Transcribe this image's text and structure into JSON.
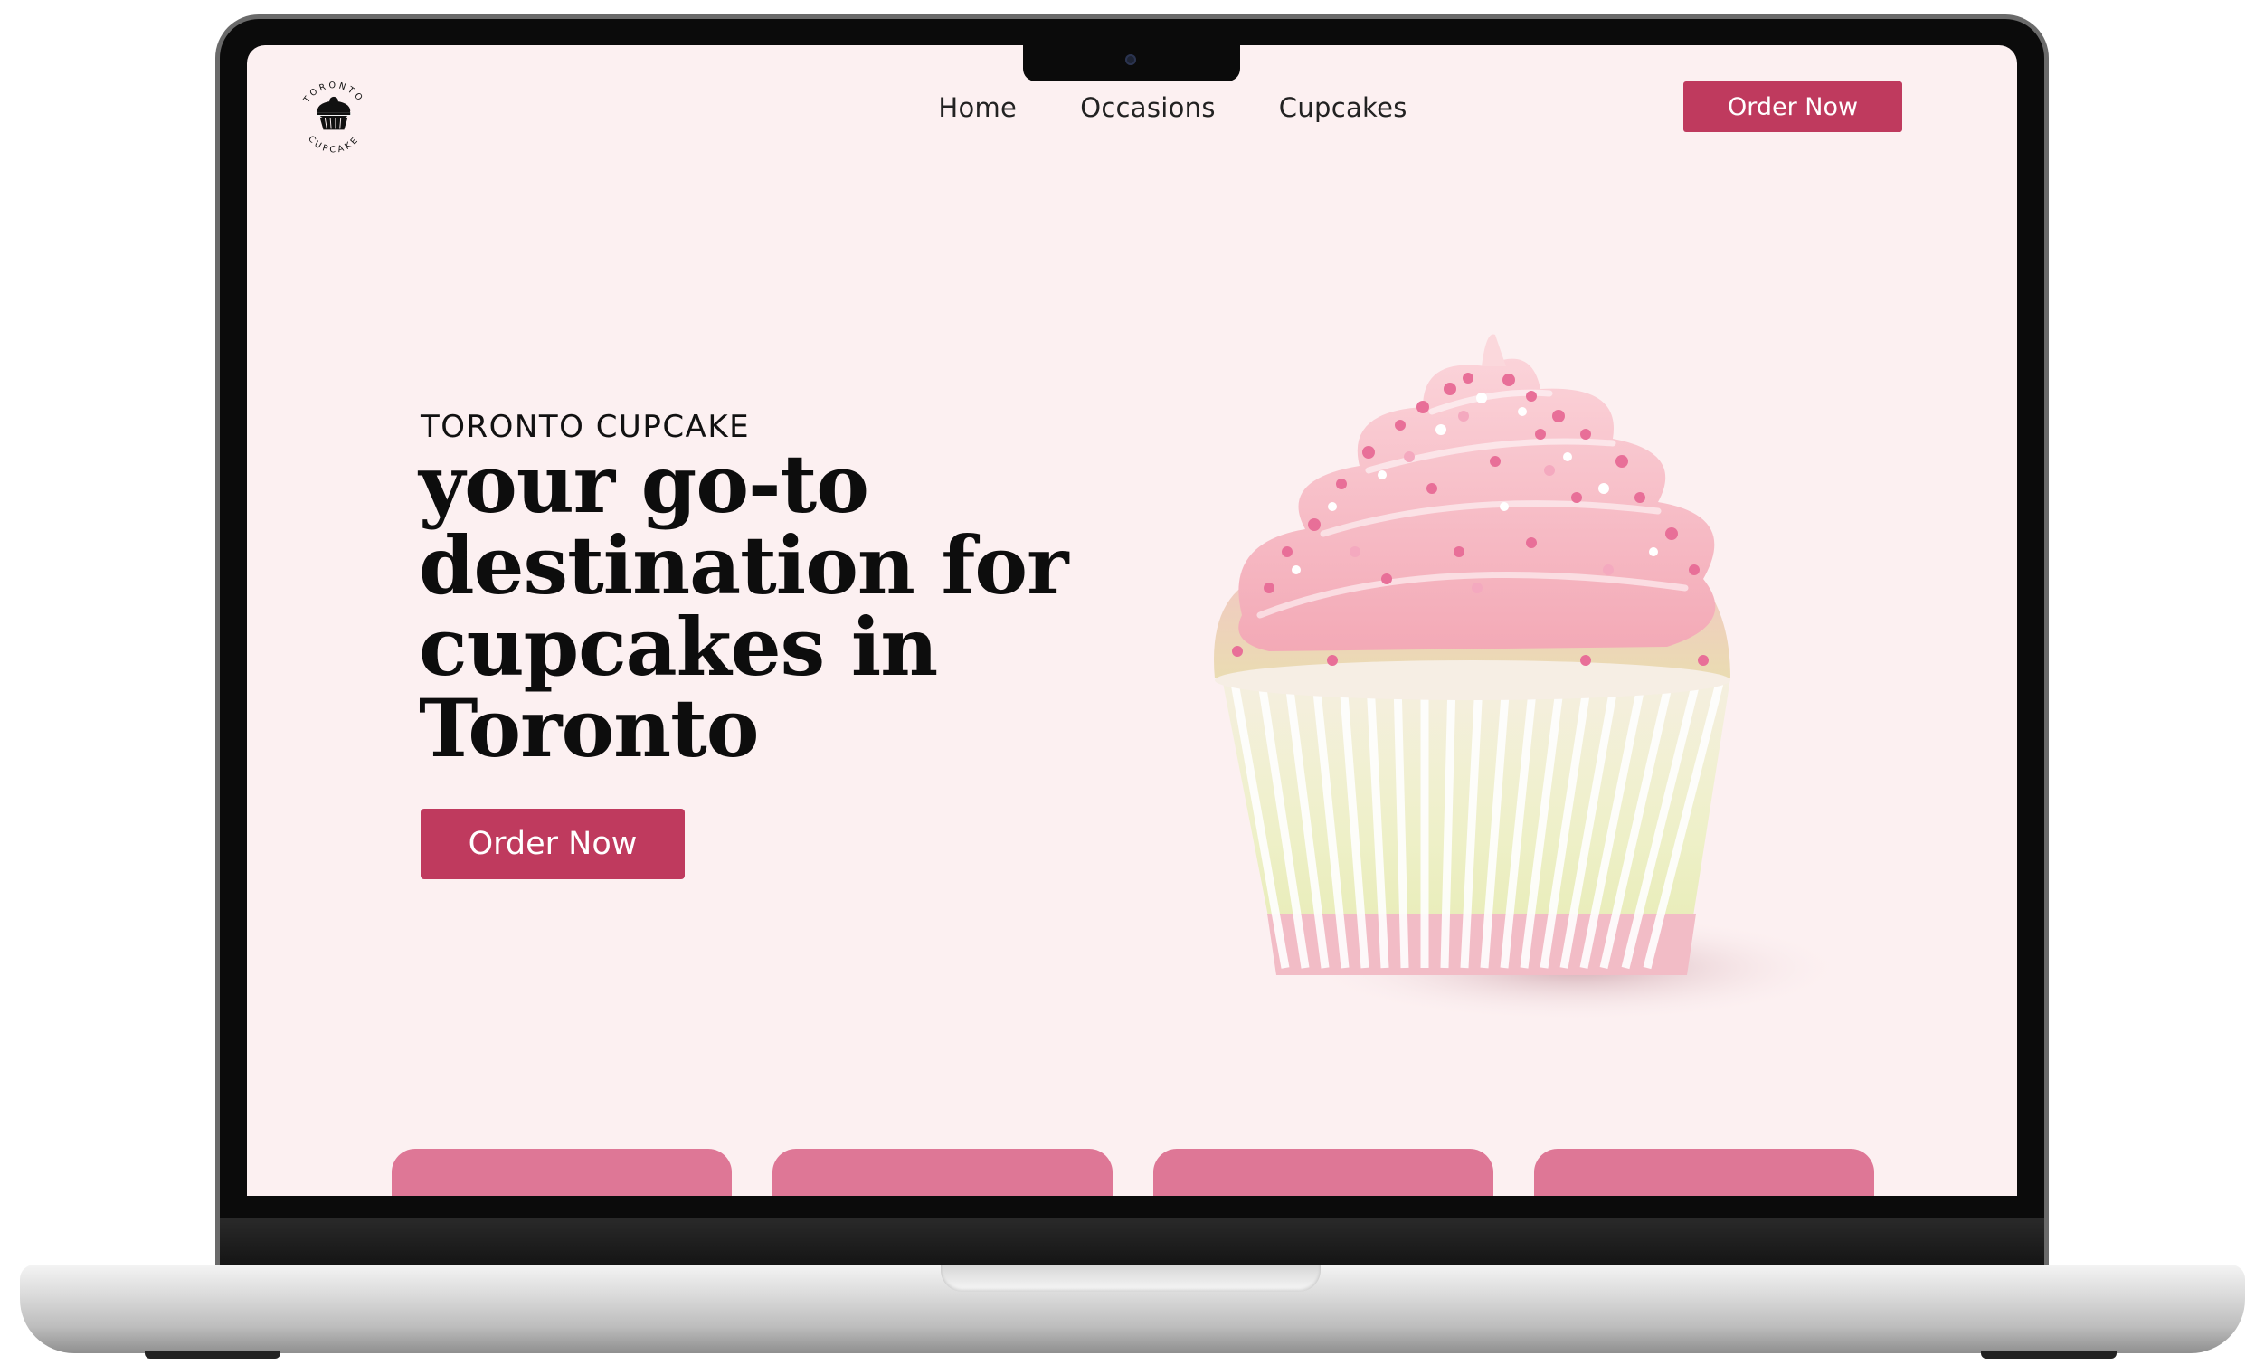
{
  "brand": {
    "logo_top_text": "TORONTO",
    "logo_bottom_text": "CUPCAKE",
    "accent_color": "#bf3a5e",
    "card_color": "#de7796",
    "background_color": "#fcf0f1"
  },
  "nav": {
    "items": [
      {
        "label": "Home"
      },
      {
        "label": "Occasions"
      },
      {
        "label": "Cupcakes"
      }
    ],
    "order_label": "Order Now"
  },
  "hero": {
    "eyebrow": "TORONTO CUPCAKE",
    "headline": "your go-to destination for cupcakes in Toronto",
    "order_label": "Order Now",
    "image_icon": "cupcake-image"
  },
  "cards": [
    {},
    {},
    {},
    {}
  ]
}
